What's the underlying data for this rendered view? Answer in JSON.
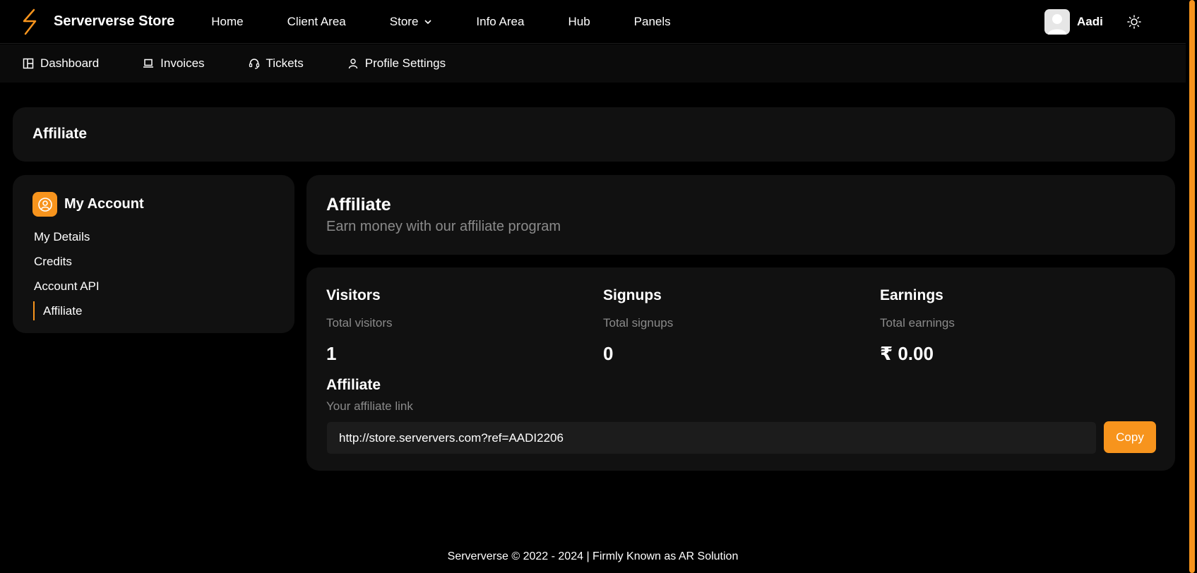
{
  "header": {
    "brand": "Serververse Store",
    "nav": [
      {
        "label": "Home"
      },
      {
        "label": "Client Area"
      },
      {
        "label": "Store",
        "has_dropdown": true
      },
      {
        "label": "Info Area"
      },
      {
        "label": "Hub"
      },
      {
        "label": "Panels"
      }
    ],
    "user_name": "Aadi"
  },
  "subnav": [
    {
      "label": "Dashboard",
      "icon": "dashboard-icon"
    },
    {
      "label": "Invoices",
      "icon": "laptop-icon"
    },
    {
      "label": "Tickets",
      "icon": "headset-icon"
    },
    {
      "label": "Profile Settings",
      "icon": "user-icon"
    }
  ],
  "page_title": "Affiliate",
  "sidebar": {
    "title": "My Account",
    "items": [
      {
        "label": "My Details"
      },
      {
        "label": "Credits"
      },
      {
        "label": "Account API"
      },
      {
        "label": "Affiliate",
        "active": true
      }
    ]
  },
  "main": {
    "title": "Affiliate",
    "subtitle": "Earn money with our affiliate program",
    "stats": [
      {
        "title": "Visitors",
        "subtitle": "Total visitors",
        "value": "1"
      },
      {
        "title": "Signups",
        "subtitle": "Total signups",
        "value": "0"
      },
      {
        "title": "Earnings",
        "subtitle": "Total earnings",
        "value": "₹ 0.00"
      }
    ],
    "affiliate": {
      "title": "Affiliate",
      "subtitle": "Your affiliate link",
      "link": "http://store.serververs.com?ref=AADI2206",
      "copy_label": "Copy"
    }
  },
  "footer": "Serververse © 2022 - 2024 | Firmly Known as AR Solution",
  "colors": {
    "accent": "#f7941d",
    "background": "#000000",
    "card": "#111111"
  }
}
